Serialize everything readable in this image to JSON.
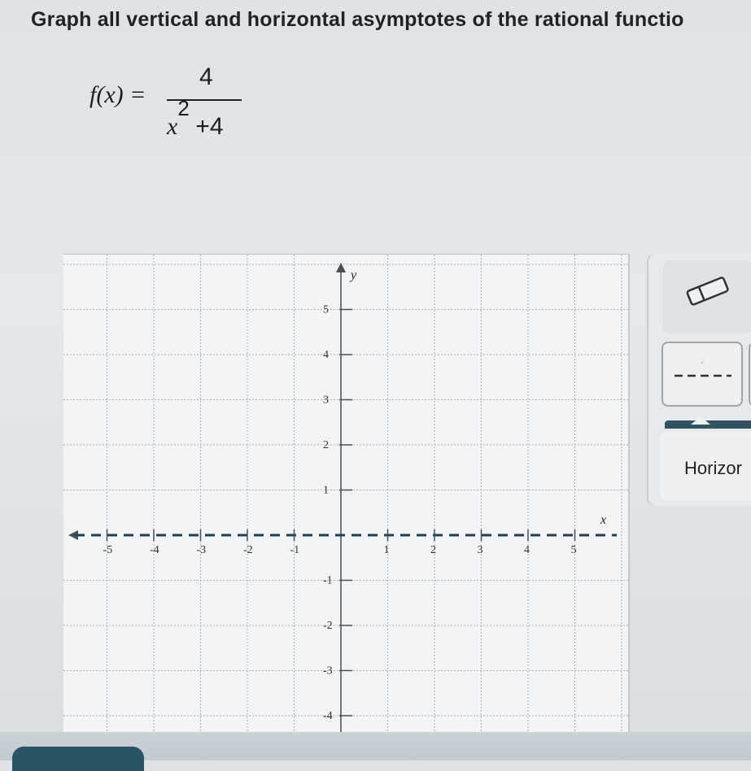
{
  "question": {
    "text": "Graph all vertical and horizontal asymptotes of the rational functio"
  },
  "formula": {
    "lhs": "f(x) =",
    "numerator": "4",
    "denominator_var": "x",
    "denominator_exp": "2",
    "denominator_rest": "+4"
  },
  "graph": {
    "x_axis_label": "x",
    "y_axis_label": "y",
    "x_range": [
      -6,
      6
    ],
    "y_range": [
      -4.3,
      6
    ],
    "x_ticks": [
      {
        "v": -5,
        "label": "-5"
      },
      {
        "v": -4,
        "label": "-4"
      },
      {
        "v": -3,
        "label": "-3"
      },
      {
        "v": -2,
        "label": "-2"
      },
      {
        "v": -1,
        "label": "-1"
      },
      {
        "v": 1,
        "label": "1"
      },
      {
        "v": 2,
        "label": "2"
      },
      {
        "v": 3,
        "label": "3"
      },
      {
        "v": 4,
        "label": "4"
      },
      {
        "v": 5,
        "label": "5"
      }
    ],
    "y_ticks": [
      {
        "v": 5,
        "label": "5"
      },
      {
        "v": 4,
        "label": "4"
      },
      {
        "v": 3,
        "label": "3"
      },
      {
        "v": 2,
        "label": "2"
      },
      {
        "v": 1,
        "label": "1"
      },
      {
        "v": -1,
        "label": "-1"
      },
      {
        "v": -2,
        "label": "-2"
      },
      {
        "v": -3,
        "label": "-3"
      },
      {
        "v": -4,
        "label": "-4"
      }
    ],
    "asymptote": {
      "type": "horizontal",
      "y": 0,
      "style": "dashed"
    },
    "colors": {
      "grid": "#a9aeb2",
      "axis": "#4a4f53",
      "asymptote": "#1f4150"
    }
  },
  "tools": {
    "eraser_icon": "eraser-icon",
    "dashed_icon": "dashed-line-icon",
    "horizontal_label": "Horizor"
  }
}
